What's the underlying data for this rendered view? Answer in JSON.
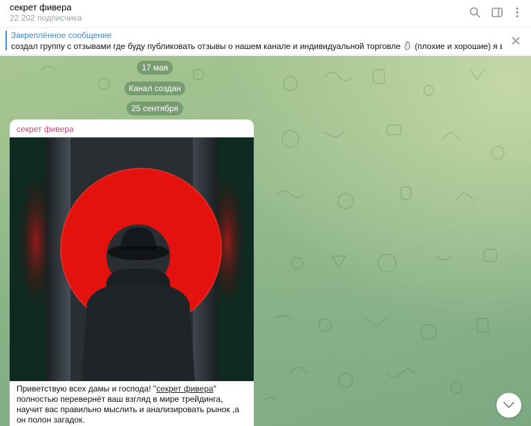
{
  "header": {
    "title": "секрет фивера",
    "subtitle": "22 202 подписчика",
    "icons": [
      "search-icon",
      "sidebar-toggle-icon",
      "more-vertical-icon"
    ]
  },
  "pinned": {
    "title": "Закреплённое сообщение",
    "text_before": "создал группу с отзывами где буду публиковать отзывы о нашем канале и индивидуальной торговле",
    "text_after": "(плохие и хорошие)  я всегда ...",
    "emoji": "hand-icon"
  },
  "service": {
    "date1": "17 мая",
    "created": "Канал создан",
    "date2": "25 сентября"
  },
  "message": {
    "sender": "секрет фивера",
    "caption_before": "Приветствую всех дамы и господа! \"",
    "caption_link": "секрет фивера",
    "caption_after": "\" полностью перевернёт ваш взгляд в мире трейдинга, научит вас правильно мыслить и анализировать рынок ,а он полон загадок."
  },
  "colors": {
    "accent": "#3a8bd1",
    "sender": "#d1457a",
    "pill": "#5a8258"
  }
}
